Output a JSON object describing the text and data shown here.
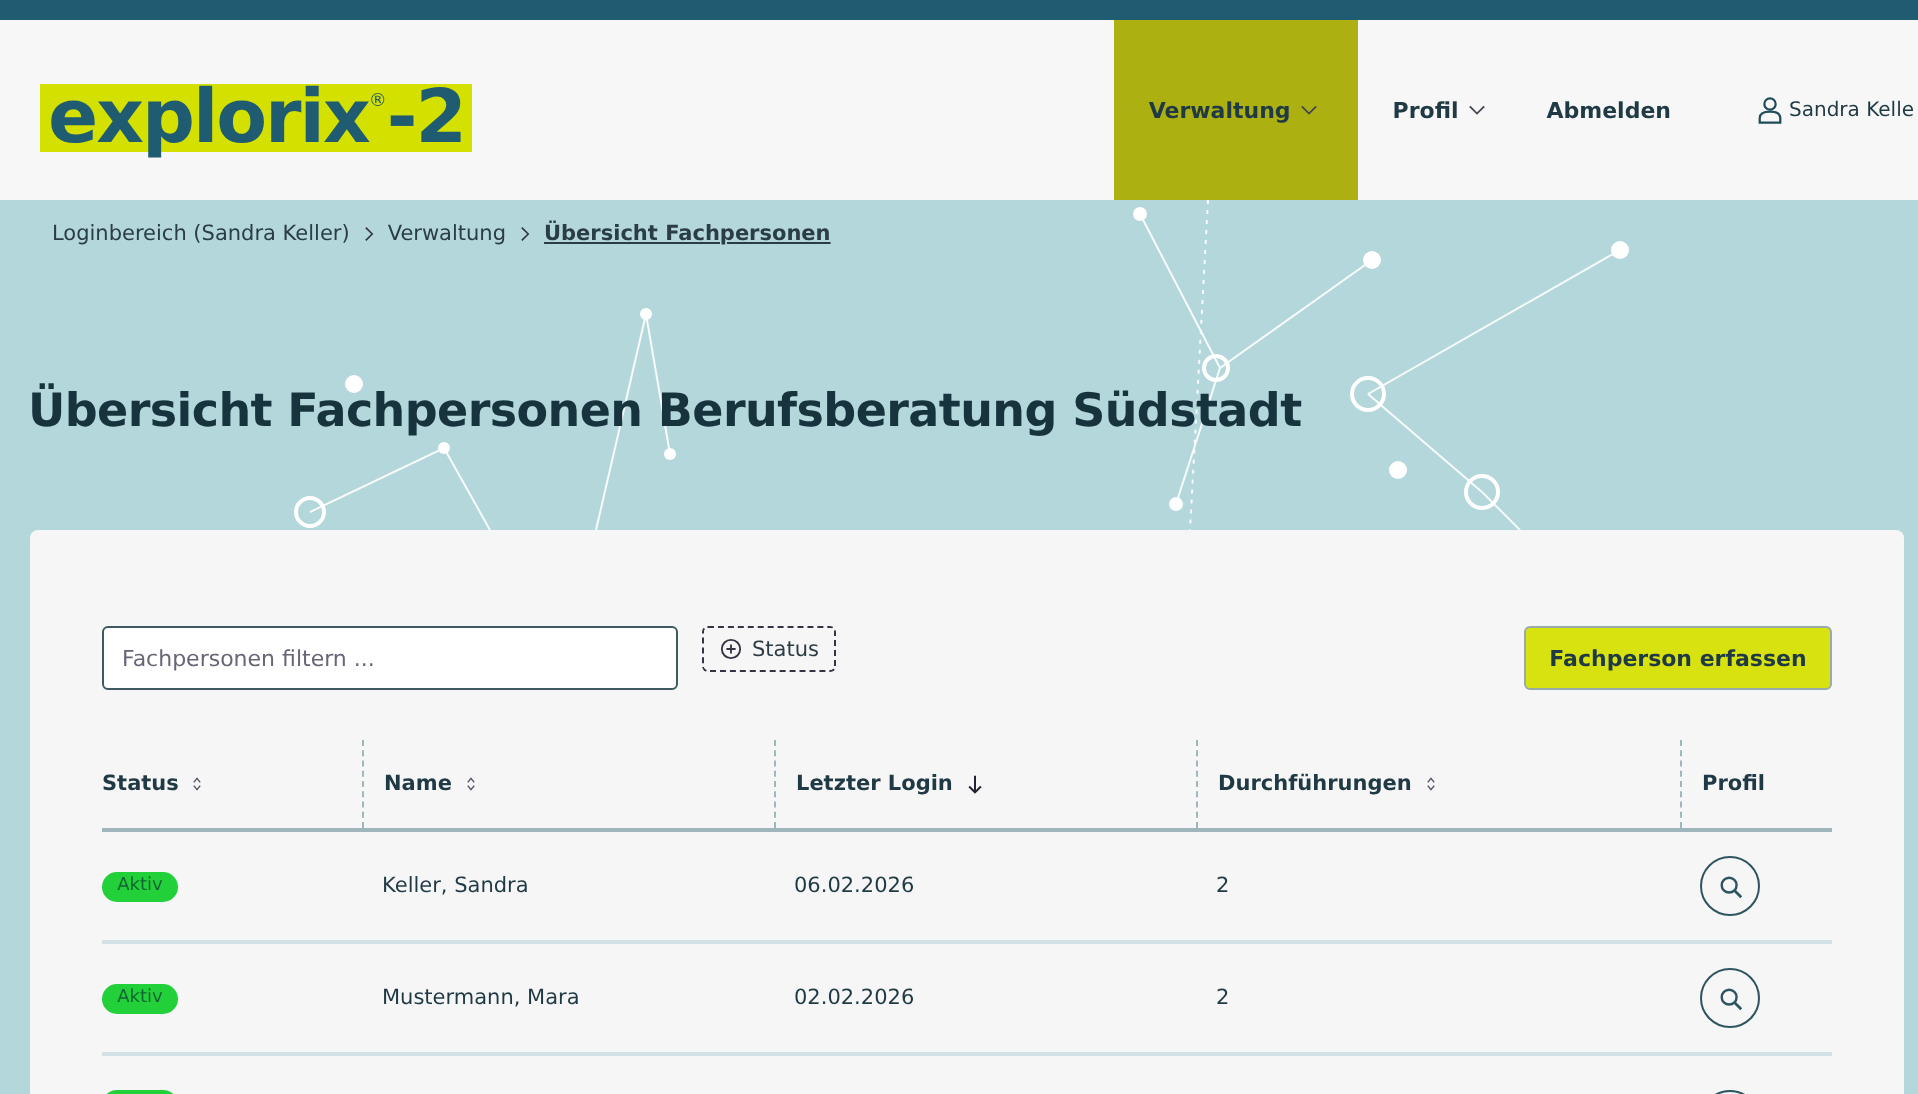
{
  "logo": {
    "text": "explorix",
    "mark": "®",
    "suffix": "-2"
  },
  "nav": [
    {
      "label": "Verwaltung",
      "dropdown": true,
      "selected": true
    },
    {
      "label": "Profil",
      "dropdown": true,
      "selected": false
    },
    {
      "label": "Abmelden",
      "dropdown": false,
      "selected": false
    }
  ],
  "user": {
    "name": "Sandra Kelle"
  },
  "breadcrumb": [
    {
      "label": "Loginbereich (Sandra Keller)",
      "current": false
    },
    {
      "label": "Verwaltung",
      "current": false
    },
    {
      "label": "Übersicht Fachpersonen",
      "current": true
    }
  ],
  "title": "Übersicht Fachpersonen Berufsberatung Südstadt",
  "filter": {
    "placeholder": "Fachpersonen filtern ..."
  },
  "status_filter": {
    "label": "Status"
  },
  "add_button": {
    "label": "Fachperson erfassen"
  },
  "table": {
    "columns": [
      {
        "label": "Status",
        "kind": "sortable"
      },
      {
        "label": "Name",
        "kind": "sortable"
      },
      {
        "label": "Letzter Login",
        "kind": "sorted"
      },
      {
        "label": "Durchführungen",
        "kind": "sortable"
      },
      {
        "label": "Profil",
        "kind": "plain"
      }
    ],
    "rows": [
      {
        "cut_off": false,
        "status": "Aktiv",
        "color": "#22d03a",
        "name": "Keller, Sandra",
        "last_login": "06.02.2026",
        "runs": "2"
      },
      {
        "cut_off": false,
        "status": "Aktiv",
        "color": "#22d03a",
        "name": "Mustermann, Mara",
        "last_login": "02.02.2026",
        "runs": "2"
      },
      {
        "cut_off": true,
        "color": "#22d03a"
      }
    ]
  }
}
